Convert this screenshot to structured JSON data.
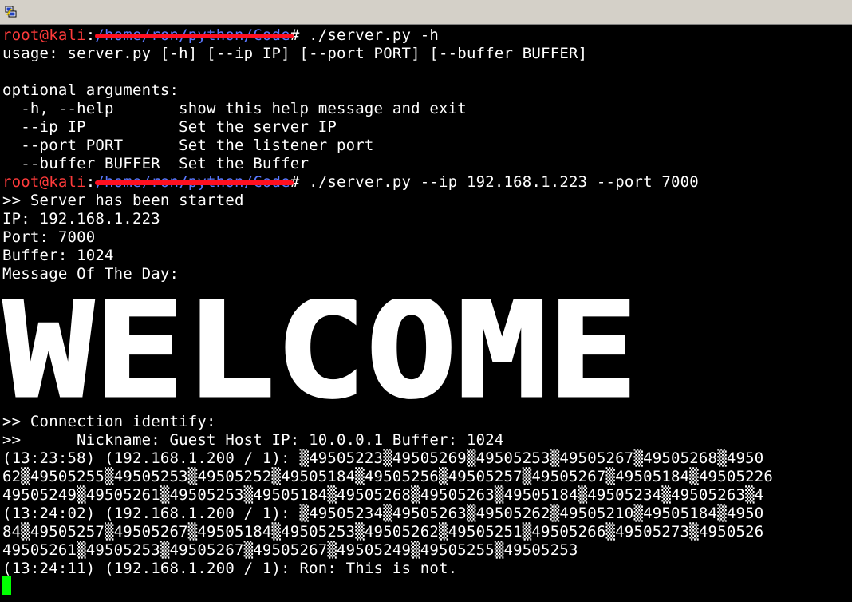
{
  "window": {
    "title": ""
  },
  "terminal": {
    "session1": {
      "user": "root@kali",
      "sep": ":",
      "path": "/home/ron/python/Code",
      "hash": "#",
      "command": " ./server.py -h"
    },
    "help": {
      "usage": "usage: server.py [-h] [--ip IP] [--port PORT] [--buffer BUFFER]",
      "optional_header": "optional arguments:",
      "options": [
        "  -h, --help       show this help message and exit",
        "  --ip IP          Set the server IP",
        "  --port PORT      Set the listener port",
        "  --buffer BUFFER  Set the Buffer"
      ]
    },
    "session2": {
      "user": "root@kali",
      "sep": ":",
      "path": "/home/ron/python/Code",
      "hash": "#",
      "command": " ./server.py --ip 192.168.1.223 --port 7000"
    },
    "server": {
      "started": ">> Server has been started",
      "ip": "IP: 192.168.1.223",
      "port": "Port: 7000",
      "buffer": "Buffer: 1024",
      "motd": "Message Of The Day:"
    },
    "banner_text": "WELCOME",
    "connection": {
      "identify": ">> Connection identify:",
      "details": ">>      Nickname: Guest Host IP: 10.0.0.1 Buffer: 1024"
    },
    "messages": [
      "(13:23:58) (192.168.1.200 / 1): ▒49505223▒49505269▒49505253▒49505267▒49505268▒4950",
      "62▒49505255▒49505253▒49505252▒49505184▒49505256▒49505257▒49505267▒49505184▒49505226",
      "49505249▒49505261▒49505253▒49505184▒49505268▒49505263▒49505184▒49505234▒49505263▒4",
      "(13:24:02) (192.168.1.200 / 1): ▒49505234▒49505263▒49505262▒49505210▒49505184▒4950",
      "84▒49505257▒49505267▒49505184▒49505253▒49505262▒49505251▒49505266▒49505273▒4950526",
      "49505261▒49505253▒49505267▒49505267▒49505249▒49505255▒49505253",
      "(13:24:11) (192.168.1.200 / 1): Ron: This is not."
    ]
  }
}
